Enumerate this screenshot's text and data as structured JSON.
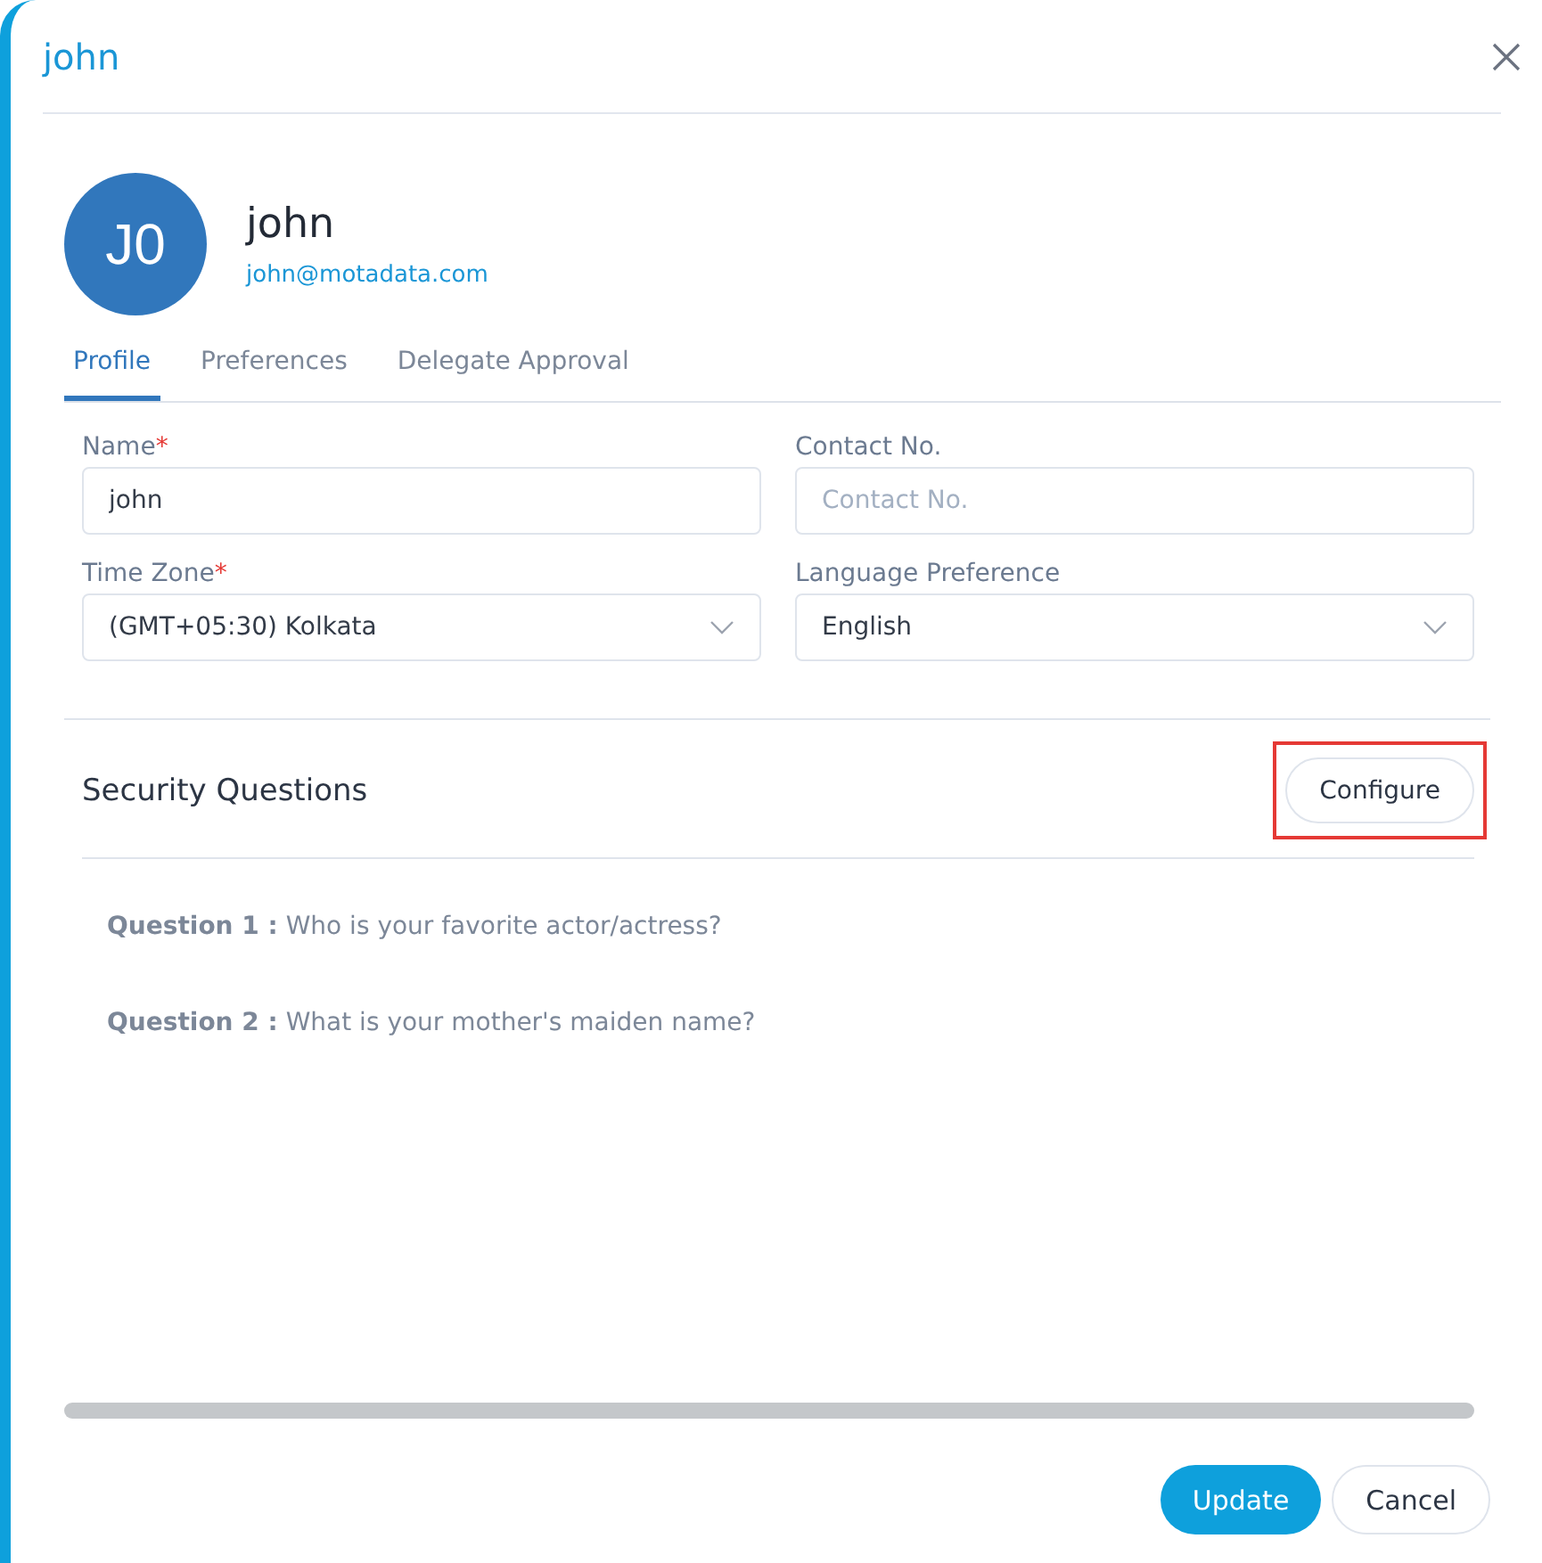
{
  "dialog": {
    "title": "john"
  },
  "profile": {
    "initials": "J0",
    "name": "john",
    "email": "john@motadata.com"
  },
  "tabs": [
    {
      "label": "Profile",
      "selected": true
    },
    {
      "label": "Preferences",
      "selected": false
    },
    {
      "label": "Delegate Approval",
      "selected": false
    }
  ],
  "fields": [
    {
      "kind": "text",
      "label": "Name",
      "required_mark": "*",
      "value": "john"
    },
    {
      "kind": "text",
      "label": "Contact No.",
      "placeholder": "Contact No."
    },
    {
      "kind": "select",
      "label": "Time Zone",
      "required_mark": "*",
      "value": "(GMT+05:30) Kolkata"
    },
    {
      "kind": "select",
      "label": "Language Preference",
      "value": "English"
    }
  ],
  "security": {
    "title": "Security Questions",
    "button": {
      "label": "Configure",
      "highlighted": true
    },
    "questions": [
      "**Question 1 :** Who is your favorite actor/actress?",
      "**Question 2 :** What is your mother's maiden name?"
    ]
  },
  "buttons": [
    {
      "label": "Update",
      "kind": "primary"
    },
    {
      "label": "Cancel",
      "kind": "secondary"
    }
  ]
}
